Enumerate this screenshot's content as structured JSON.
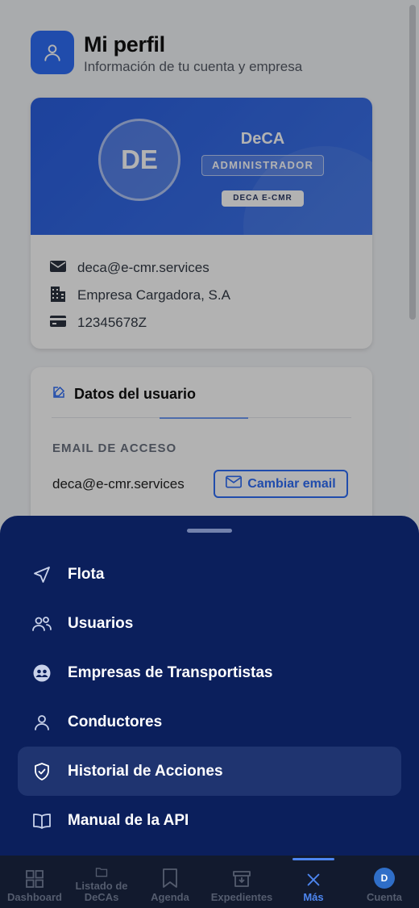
{
  "profile": {
    "title": "Mi perfil",
    "subtitle": "Información de tu cuenta y empresa",
    "avatar_initials": "DE",
    "name": "DeCA",
    "role": "ADMINISTRADOR",
    "company_badge": "DECA E-CMR",
    "email": "deca@e-cmr.services",
    "company": "Empresa Cargadora, S.A",
    "tax_id": "12345678Z"
  },
  "user_data": {
    "title": "Datos del usuario",
    "email_label": "EMAIL DE ACCESO",
    "email_value": "deca@e-cmr.services",
    "change_email_label": "Cambiar email"
  },
  "menu": {
    "items": [
      {
        "label": "Flota",
        "icon": "navigation-arrow-icon"
      },
      {
        "label": "Usuarios",
        "icon": "users-icon"
      },
      {
        "label": "Empresas de Transportistas",
        "icon": "companies-icon"
      },
      {
        "label": "Conductores",
        "icon": "user-icon"
      },
      {
        "label": "Historial de Acciones",
        "icon": "shield-check-icon",
        "active": true
      },
      {
        "label": "Manual de la API",
        "icon": "book-icon"
      }
    ]
  },
  "nav": {
    "items": [
      {
        "label": "Dashboard",
        "icon": "grid-icon"
      },
      {
        "label": "Listado de DeCAs",
        "icon": "folder-icon"
      },
      {
        "label": "Agenda",
        "icon": "bookmark-icon"
      },
      {
        "label": "Expedientes",
        "icon": "archive-icon"
      },
      {
        "label": "Más",
        "icon": "close-icon",
        "active": true
      },
      {
        "label": "Cuenta",
        "icon": "avatar",
        "avatar_initial": "D"
      }
    ]
  },
  "colors": {
    "accent": "#2f6df6",
    "sheet_background": "#0b1f5c",
    "active_menu_item": "#1f3470",
    "nav_active": "#4d86f0"
  }
}
